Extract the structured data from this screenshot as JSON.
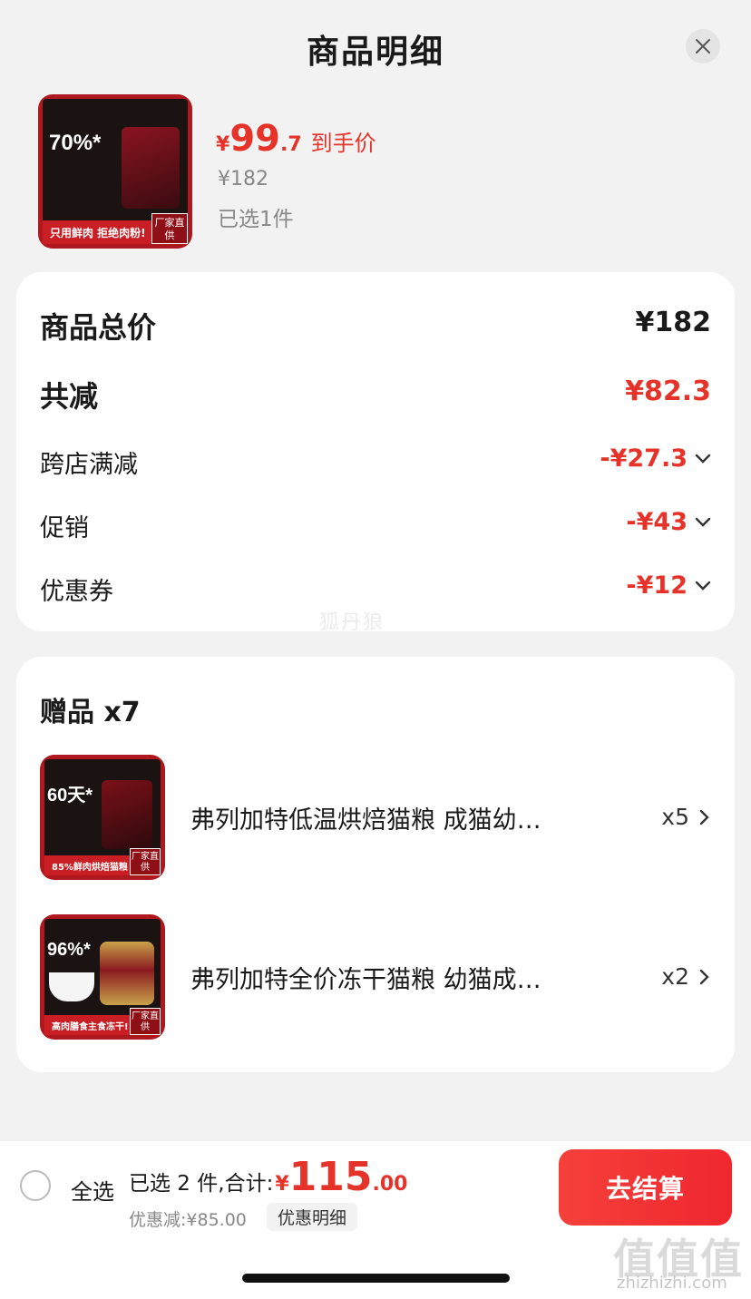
{
  "header": {
    "title": "商品明细",
    "close_icon": "close-icon"
  },
  "product": {
    "price_symbol": "¥",
    "price_integer": "99",
    "price_decimal": ".7",
    "price_label": "到手价",
    "original_price": "¥182",
    "selected_count": "已选1件",
    "thumb_percent": "70%*",
    "thumb_banner": "只用鲜肉 拒绝肉粉!",
    "thumb_badge": "厂家直供"
  },
  "summary": {
    "total_label": "商品总价",
    "total_value": "¥182",
    "reduce_label": "共减",
    "reduce_value": "¥82.3",
    "items": [
      {
        "label": "跨店满减",
        "value": "-¥27.3"
      },
      {
        "label": "促销",
        "value": "-¥43"
      },
      {
        "label": "优惠券",
        "value": "-¥12"
      }
    ]
  },
  "gifts": {
    "title": "赠品 x7",
    "items": [
      {
        "name": "弗列加特低温烘焙猫粮 成猫幼…",
        "qty": "x5",
        "thumb_percent": "60天*",
        "thumb_banner": "85%鲜肉烘焙猫粮",
        "thumb_badge": "厂家直供"
      },
      {
        "name": "弗列加特全价冻干猫粮 幼猫成…",
        "qty": "x2",
        "thumb_percent": "96%*",
        "thumb_banner": "高肉膳食主食冻干!",
        "thumb_badge": "厂家直供"
      }
    ]
  },
  "bottom_bar": {
    "select_all": "全选",
    "sum_label": "已选 2 件,合计:",
    "sum_symbol": "¥",
    "sum_integer": "115",
    "sum_decimal": ".00",
    "discount_text": "优惠减:¥85.00",
    "discount_detail": "优惠明细",
    "checkout": "去结算"
  },
  "watermarks": {
    "center": "狐丹狼",
    "logo": "值值值",
    "url": "zhizhizhi.com"
  },
  "colors": {
    "accent_red": "#e6332a",
    "button_red": "#f5403a",
    "background": "#f2f2f2"
  }
}
